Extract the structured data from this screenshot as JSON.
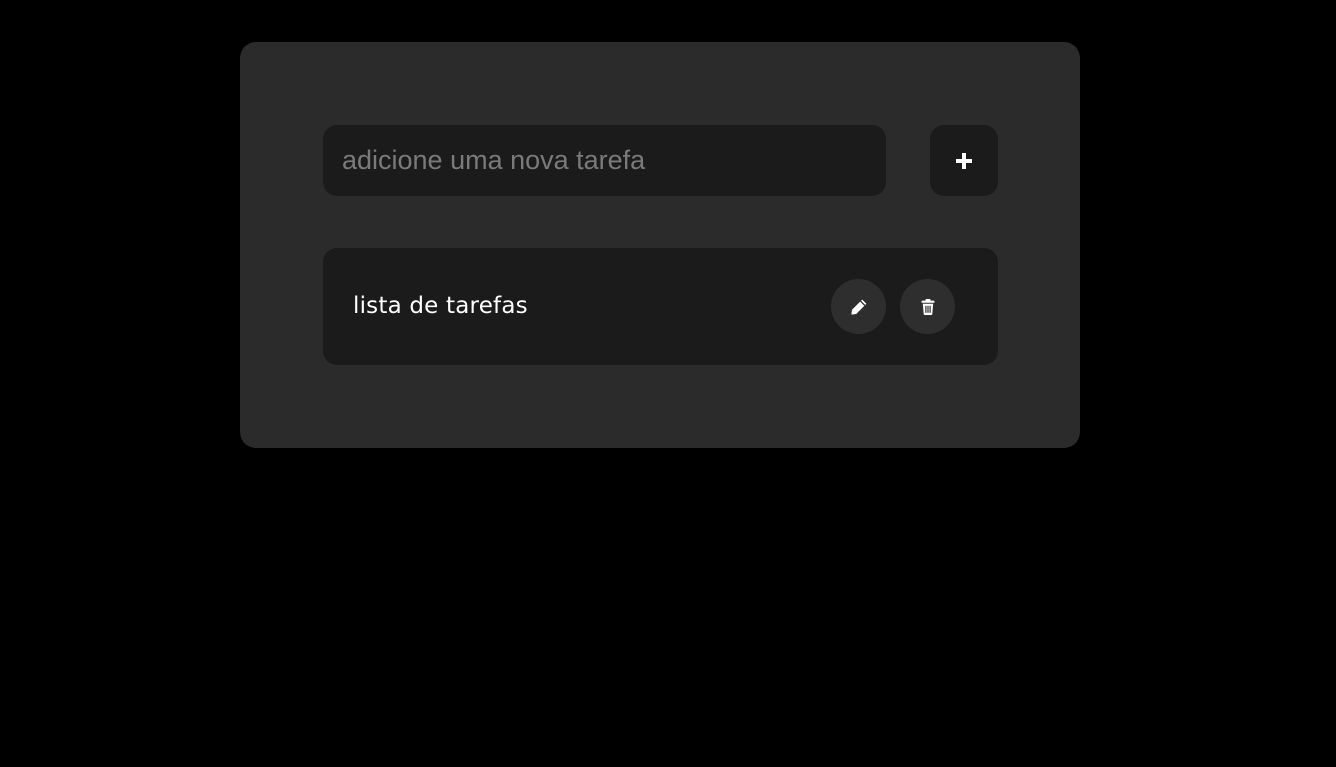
{
  "new_task": {
    "placeholder": "adicione uma nova tarefa",
    "value": ""
  },
  "add_button": {
    "icon": "plus-icon"
  },
  "tasks": [
    {
      "label": "lista de tarefas",
      "edit_icon": "pencil-icon",
      "delete_icon": "trash-icon"
    }
  ],
  "colors": {
    "background": "#000000",
    "card": "#2b2b2b",
    "field": "#1b1b1b",
    "round_button": "#2e2e2e",
    "text": "#ffffff",
    "placeholder": "#7a7a7a"
  }
}
